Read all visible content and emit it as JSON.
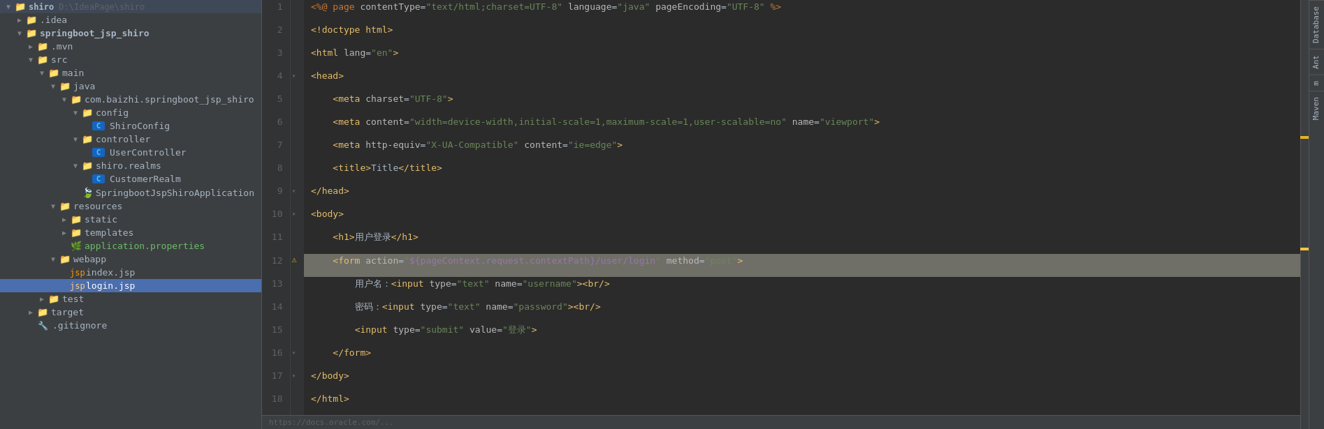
{
  "filetree": {
    "root": {
      "label": "shiro D:\\IdeaPage\\shiro",
      "icon": "folder",
      "expanded": true
    },
    "items": [
      {
        "id": "idea",
        "label": ".idea",
        "depth": 1,
        "type": "folder",
        "expanded": false,
        "arrow": true
      },
      {
        "id": "springboot_jsp_shiro",
        "label": "springboot_jsp_shiro",
        "depth": 1,
        "type": "folder-module",
        "expanded": true,
        "arrow": true
      },
      {
        "id": "mvn",
        "label": ".mvn",
        "depth": 2,
        "type": "folder",
        "expanded": false,
        "arrow": true
      },
      {
        "id": "src",
        "label": "src",
        "depth": 2,
        "type": "folder",
        "expanded": true,
        "arrow": true
      },
      {
        "id": "main",
        "label": "main",
        "depth": 3,
        "type": "folder",
        "expanded": true,
        "arrow": true
      },
      {
        "id": "java",
        "label": "java",
        "depth": 4,
        "type": "folder-src",
        "expanded": true,
        "arrow": true
      },
      {
        "id": "com_pkg",
        "label": "com.baizhi.springboot_jsp_shiro",
        "depth": 5,
        "type": "folder-pkg",
        "expanded": true,
        "arrow": true
      },
      {
        "id": "config",
        "label": "config",
        "depth": 6,
        "type": "folder",
        "expanded": true,
        "arrow": true
      },
      {
        "id": "ShiroConfig",
        "label": "ShiroConfig",
        "depth": 7,
        "type": "java-class",
        "arrow": false
      },
      {
        "id": "controller",
        "label": "controller",
        "depth": 6,
        "type": "folder",
        "expanded": true,
        "arrow": true
      },
      {
        "id": "UserController",
        "label": "UserController",
        "depth": 7,
        "type": "java-class",
        "arrow": false
      },
      {
        "id": "shiro_realms",
        "label": "shiro.realms",
        "depth": 6,
        "type": "folder-pkg",
        "expanded": true,
        "arrow": true
      },
      {
        "id": "CustomerRealm",
        "label": "CustomerRealm",
        "depth": 7,
        "type": "java-class",
        "arrow": false
      },
      {
        "id": "SpringbootJspShiroApplication",
        "label": "SpringbootJspShiroApplication",
        "depth": 6,
        "type": "java-app",
        "arrow": false
      },
      {
        "id": "resources",
        "label": "resources",
        "depth": 4,
        "type": "folder-res",
        "expanded": true,
        "arrow": true
      },
      {
        "id": "static",
        "label": "static",
        "depth": 5,
        "type": "folder",
        "expanded": false,
        "arrow": true
      },
      {
        "id": "templates",
        "label": "templates",
        "depth": 5,
        "type": "folder",
        "expanded": false,
        "arrow": true
      },
      {
        "id": "application_properties",
        "label": "application.properties",
        "depth": 5,
        "type": "properties",
        "arrow": false
      },
      {
        "id": "webapp",
        "label": "webapp",
        "depth": 4,
        "type": "folder",
        "expanded": true,
        "arrow": true
      },
      {
        "id": "index_jsp",
        "label": "index.jsp",
        "depth": 5,
        "type": "jsp",
        "arrow": false
      },
      {
        "id": "login_jsp",
        "label": "login.jsp",
        "depth": 5,
        "type": "jsp",
        "selected": true,
        "arrow": false
      },
      {
        "id": "test",
        "label": "test",
        "depth": 3,
        "type": "folder",
        "expanded": false,
        "arrow": true
      },
      {
        "id": "target",
        "label": "target",
        "depth": 2,
        "type": "folder",
        "expanded": false,
        "arrow": true
      },
      {
        "id": "gitignore",
        "label": ".gitignore",
        "depth": 2,
        "type": "gitignore",
        "arrow": false
      }
    ]
  },
  "code": {
    "lines": [
      {
        "num": 1,
        "content": "<%@ page contentType=\"text/html;charset=UTF-8\" language=\"java\" pageEncoding=\"UTF-8\" %>",
        "fold": false,
        "highlight": false,
        "warning": false
      },
      {
        "num": 2,
        "content": "<!doctype html>",
        "fold": false,
        "highlight": false,
        "warning": false
      },
      {
        "num": 3,
        "content": "<html lang=\"en\">",
        "fold": false,
        "highlight": false,
        "warning": false
      },
      {
        "num": 4,
        "content": "<head>",
        "fold": true,
        "highlight": false,
        "warning": false
      },
      {
        "num": 5,
        "content": "    <meta charset=\"UTF-8\">",
        "fold": false,
        "highlight": false,
        "warning": false
      },
      {
        "num": 6,
        "content": "    <meta content=\"width=device-width,initial-scale=1,maximum-scale=1,user-scalable=no\" name=\"viewport\">",
        "fold": false,
        "highlight": false,
        "warning": false
      },
      {
        "num": 7,
        "content": "    <meta http-equiv=\"X-UA-Compatible\" content=\"ie=edge\">",
        "fold": false,
        "highlight": false,
        "warning": false
      },
      {
        "num": 8,
        "content": "    <title>Title</title>",
        "fold": false,
        "highlight": false,
        "warning": false
      },
      {
        "num": 9,
        "content": "</head>",
        "fold": true,
        "highlight": false,
        "warning": false
      },
      {
        "num": 10,
        "content": "<body>",
        "fold": true,
        "highlight": false,
        "warning": false
      },
      {
        "num": 11,
        "content": "    <h1>用户登录</h1>",
        "fold": false,
        "highlight": false,
        "warning": false
      },
      {
        "num": 12,
        "content": "    <form action=\"${pageContext.request.contextPath}/user/login\" method=\"post\">",
        "fold": false,
        "highlight": true,
        "warning": true
      },
      {
        "num": 13,
        "content": "        用户名：<input type=\"text\" name=\"username\"><br/>",
        "fold": false,
        "highlight": false,
        "warning": false
      },
      {
        "num": 14,
        "content": "        密码：<input type=\"text\" name=\"password\"><br/>",
        "fold": false,
        "highlight": false,
        "warning": false
      },
      {
        "num": 15,
        "content": "        <input type=\"submit\" value=\"登录\">",
        "fold": false,
        "highlight": false,
        "warning": false
      },
      {
        "num": 16,
        "content": "    </form>",
        "fold": true,
        "highlight": false,
        "warning": false
      },
      {
        "num": 17,
        "content": "</body>",
        "fold": true,
        "highlight": false,
        "warning": false
      },
      {
        "num": 18,
        "content": "</html>",
        "fold": false,
        "highlight": false,
        "warning": false
      }
    ]
  },
  "sidebar_tabs": [
    "Database",
    "Ant",
    "m",
    "Maven"
  ],
  "status_bar": "https://docs.oracle.com/..."
}
